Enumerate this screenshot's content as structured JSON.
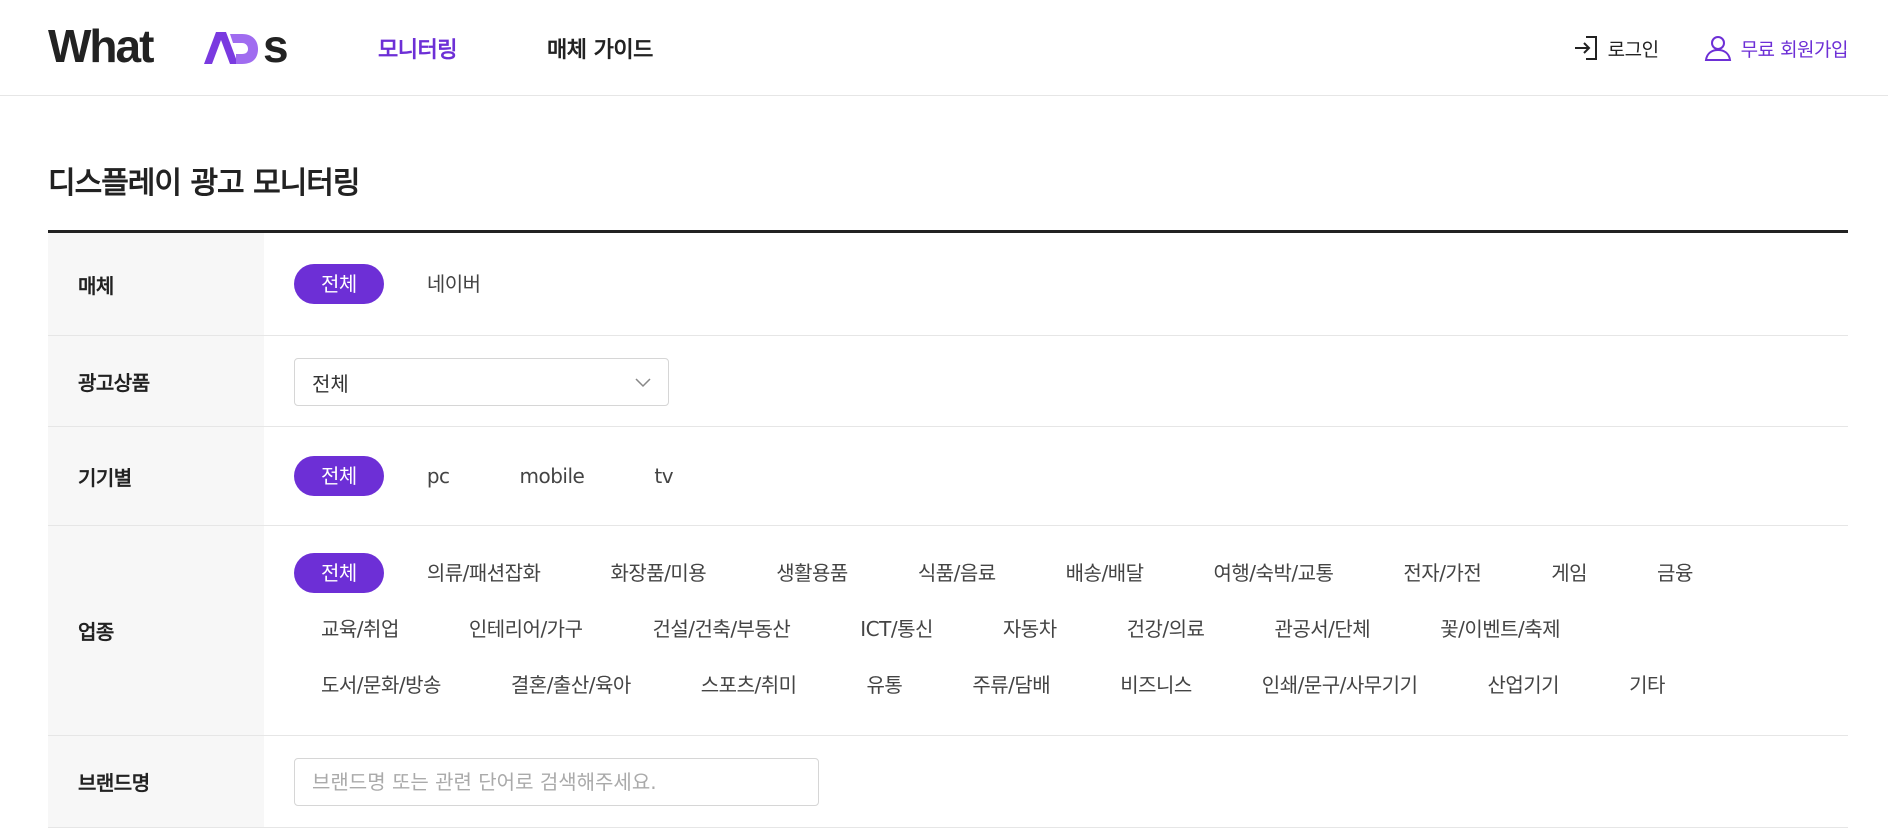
{
  "brand": {
    "logo_text_main": "What",
    "logo_text_ad": "AD",
    "logo_text_s": "s",
    "accent": "#6d2fd6"
  },
  "nav": [
    {
      "label": "모니터링",
      "active": true
    },
    {
      "label": "매체 가이드",
      "active": false
    }
  ],
  "util": {
    "login": "로그인",
    "signup": "무료 회원가입"
  },
  "page": {
    "title": "디스플레이 광고 모니터링"
  },
  "filters": {
    "media": {
      "label": "매체",
      "options": [
        "전체",
        "네이버"
      ],
      "selected": "전체"
    },
    "ad_product": {
      "label": "광고상품",
      "value": "전체"
    },
    "device": {
      "label": "기기별",
      "options": [
        "전체",
        "pc",
        "mobile",
        "tv"
      ],
      "selected": "전체"
    },
    "industry": {
      "label": "업종",
      "selected": "전체",
      "lines": [
        [
          "전체",
          "의류/패션잡화",
          "화장품/미용",
          "생활용품",
          "식품/음료",
          "배송/배달",
          "여행/숙박/교통",
          "전자/가전",
          "게임",
          "금융"
        ],
        [
          "교육/취업",
          "인테리어/가구",
          "건설/건축/부동산",
          "ICT/통신",
          "자동차",
          "건강/의료",
          "관공서/단체",
          "꽃/이벤트/축제"
        ],
        [
          "도서/문화/방송",
          "결혼/출산/육아",
          "스포츠/취미",
          "유통",
          "주류/담배",
          "비즈니스",
          "인쇄/문구/사무기기",
          "산업기기",
          "기타"
        ]
      ]
    },
    "brand_name": {
      "label": "브랜드명",
      "placeholder": "브랜드명 또는 관련 단어로 검색해주세요."
    }
  }
}
